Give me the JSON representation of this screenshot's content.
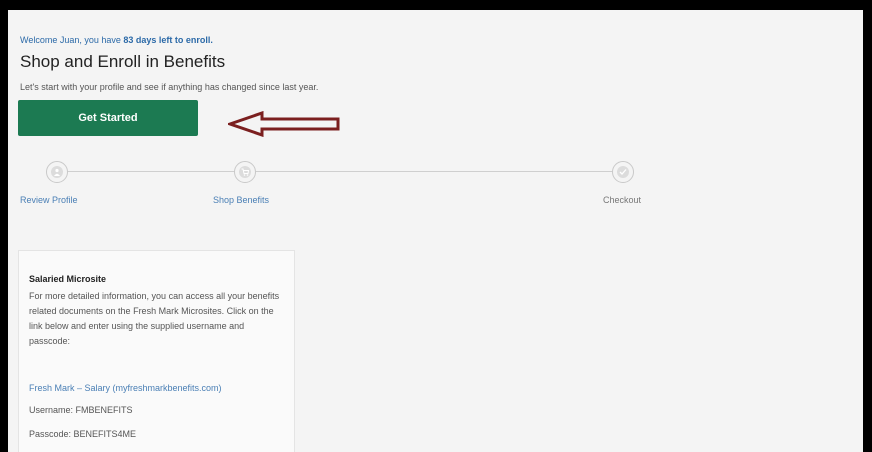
{
  "welcome": {
    "prefix": "Welcome Juan, you have ",
    "days": "83 days left to enroll."
  },
  "title": "Shop and Enroll in Benefits",
  "subtitle": "Let's start with your profile and see if anything has changed since last year.",
  "get_started_label": "Get Started",
  "arrow_color": "#7b1f1f",
  "accent_color": "#1c7a52",
  "steps": [
    {
      "label": "Review Profile",
      "icon": "person-icon"
    },
    {
      "label": "Shop Benefits",
      "icon": "cart-icon"
    },
    {
      "label": "Checkout",
      "icon": "checkmark-icon"
    }
  ],
  "card": {
    "title": "Salaried Microsite",
    "body": "For more detailed information, you can access all your benefits related documents on the Fresh Mark Microsites. Click on the link below and enter using the supplied username and passcode:",
    "link": "Fresh Mark – Salary (myfreshmarkbenefits.com)",
    "username": "Username: FMBENEFITS",
    "passcode": "Passcode: BENEFITS4ME"
  }
}
